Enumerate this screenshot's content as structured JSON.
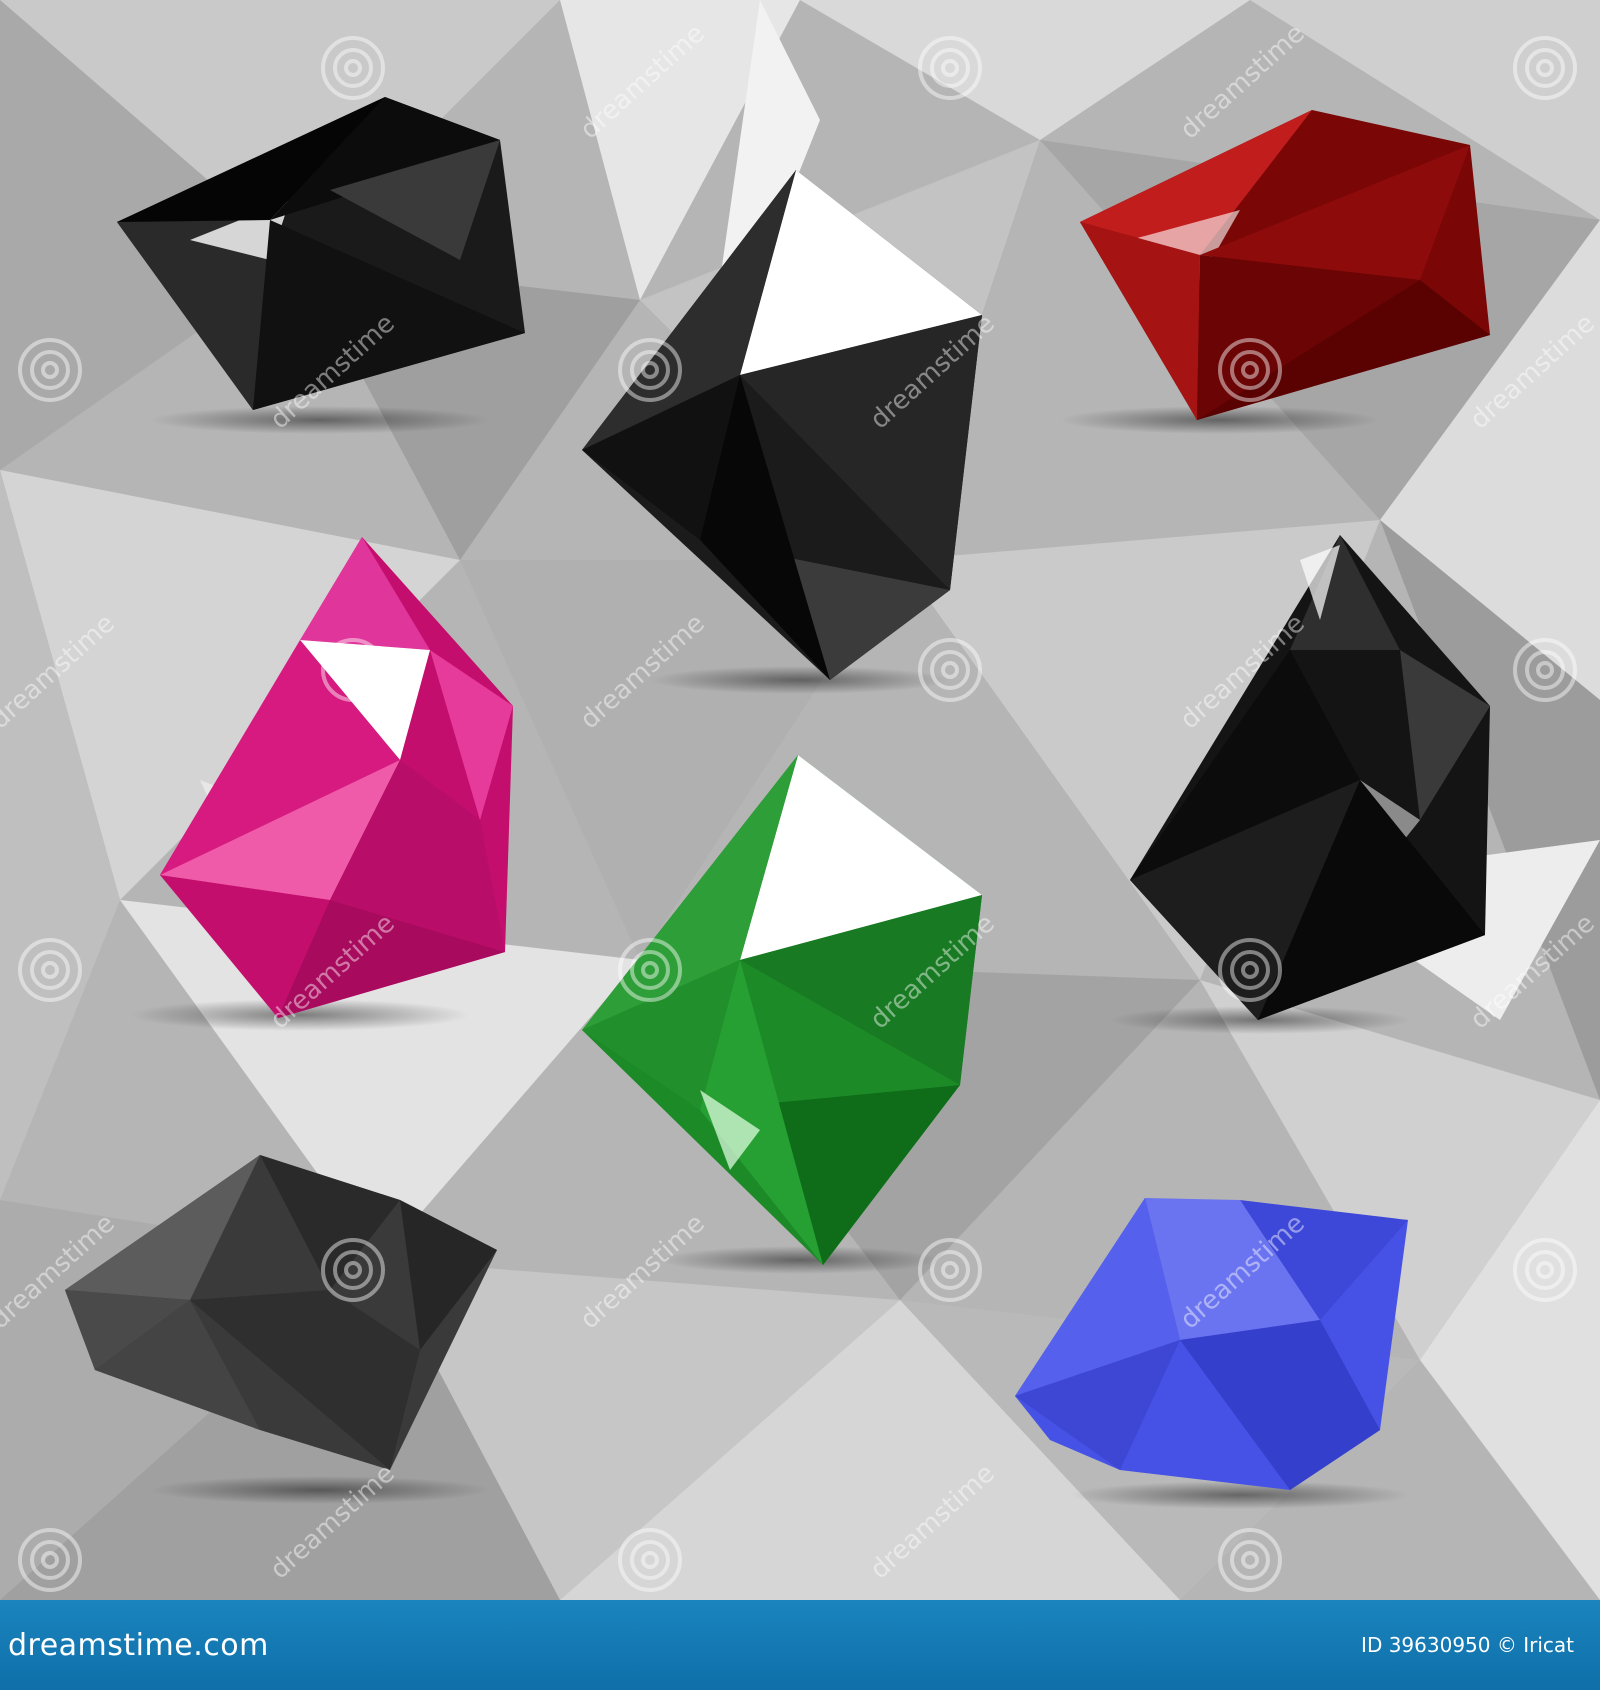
{
  "watermark": {
    "brand_text": "dreamstime",
    "logo_icon": "spiral-logo-icon"
  },
  "footer": {
    "brand": "dreamstime.com",
    "id_label": "ID 39630950 © Iricat",
    "background_color": "#1279b5"
  },
  "gems": [
    {
      "name": "black gem top-left",
      "color": "#1c1c1c"
    },
    {
      "name": "black-white gem top-center",
      "color": "#222222"
    },
    {
      "name": "red gem top-right",
      "color": "#8b0a0a"
    },
    {
      "name": "magenta gem middle-left",
      "color": "#d4127a"
    },
    {
      "name": "green gem center",
      "color": "#1f8a2a"
    },
    {
      "name": "black gem middle-right",
      "color": "#151515"
    },
    {
      "name": "dark grey gem bottom-left",
      "color": "#3a3a3a"
    },
    {
      "name": "blue gem bottom-right",
      "color": "#4650e8"
    }
  ]
}
